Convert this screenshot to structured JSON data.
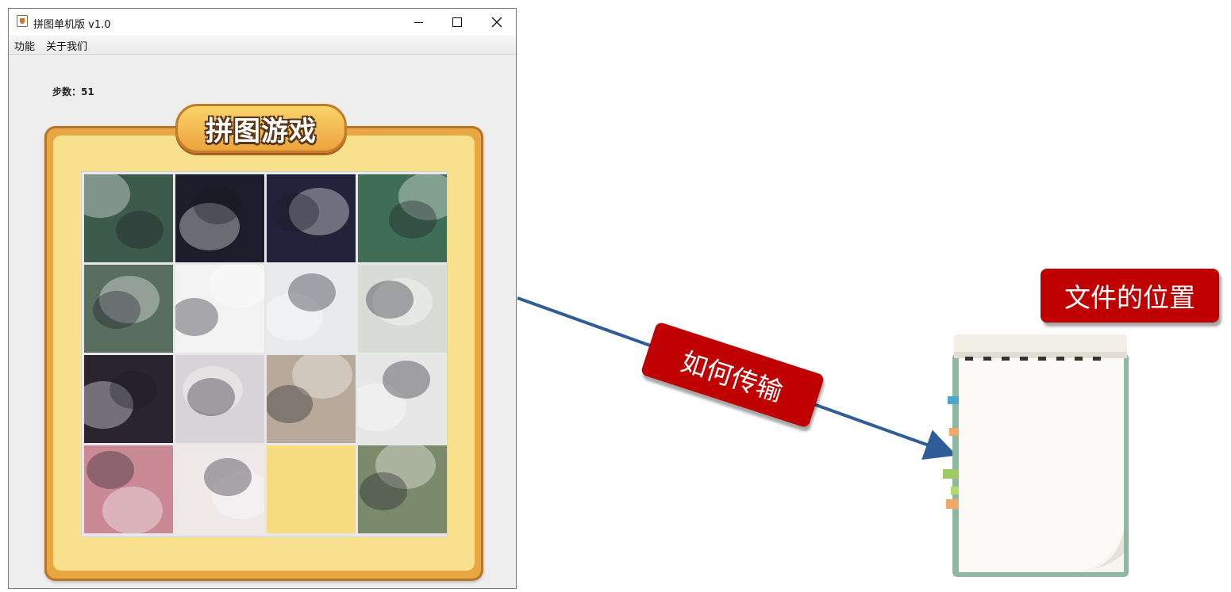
{
  "window": {
    "title": "拼图单机版 v1.0",
    "menu": [
      "功能",
      "关于我们"
    ]
  },
  "game": {
    "steps_label": "步数：51",
    "banner": "拼图游戏",
    "grid_size": 4,
    "empty_tile": {
      "row": 3,
      "col": 2
    }
  },
  "annotations": {
    "transfer_label": "如何传输",
    "location_label": "文件的位置"
  },
  "colors": {
    "label_red": "#c00000",
    "arrow_blue": "#2f5d98",
    "frame_orange": "#e9a744",
    "frame_yellow": "#f9e08d",
    "empty_tile": "#f7dd80"
  }
}
